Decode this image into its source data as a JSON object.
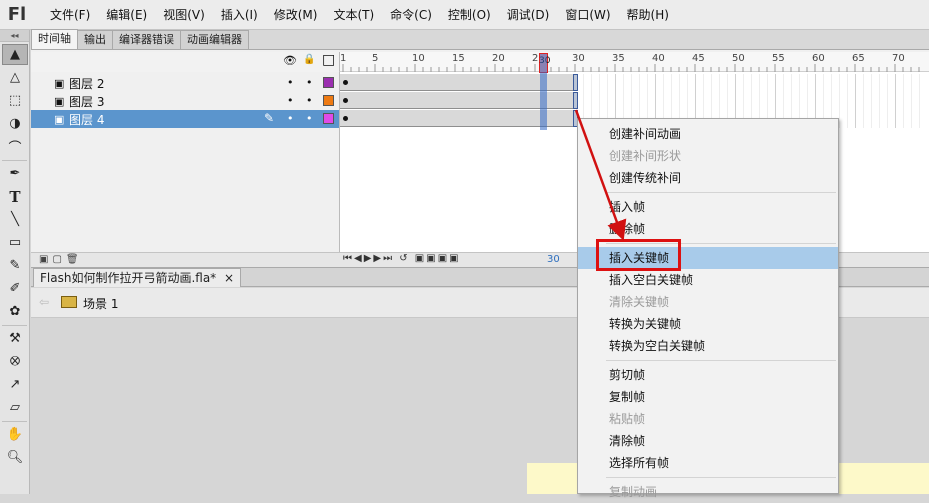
{
  "app": {
    "logo": "Fl"
  },
  "menubar": {
    "items": [
      "文件(F)",
      "编辑(E)",
      "视图(V)",
      "插入(I)",
      "修改(M)",
      "文本(T)",
      "命令(C)",
      "控制(O)",
      "调试(D)",
      "窗口(W)",
      "帮助(H)"
    ]
  },
  "toolbar": {
    "collapse": "◂◂"
  },
  "timeline": {
    "tabs": [
      "时间轴",
      "输出",
      "编译器错误",
      "动画编辑器"
    ],
    "active_tab": 0,
    "header_icons": {
      "eye": "👁",
      "lock": "🔒",
      "outline": "□"
    },
    "ruler_labels": [
      "1",
      "5",
      "10",
      "15",
      "20",
      "25",
      "30",
      "35",
      "40",
      "45",
      "50",
      "55",
      "60",
      "65",
      "70"
    ],
    "current_frame": "30",
    "layers": [
      {
        "name": "图层 2",
        "color": "#9b2fb0",
        "selected": false
      },
      {
        "name": "图层 3",
        "color": "#ee7a12",
        "selected": false
      },
      {
        "name": "图层 4",
        "color": "#e04ae8",
        "selected": true
      }
    ],
    "footer_frame": "30"
  },
  "document": {
    "tab_title": "Flash如何制作拉开弓箭动画.fla*",
    "tab_close": "×",
    "scene_label": "场景 1"
  },
  "context_menu": {
    "items": [
      {
        "label": "创建补间动画",
        "disabled": false
      },
      {
        "label": "创建补间形状",
        "disabled": true
      },
      {
        "label": "创建传统补间",
        "disabled": false
      },
      {
        "label": "插入帧",
        "disabled": false
      },
      {
        "label": "删除帧",
        "disabled": false
      },
      {
        "label": "插入关键帧",
        "disabled": false,
        "hover": true
      },
      {
        "label": "插入空白关键帧",
        "disabled": false
      },
      {
        "label": "清除关键帧",
        "disabled": true
      },
      {
        "label": "转换为关键帧",
        "disabled": false
      },
      {
        "label": "转换为空白关键帧",
        "disabled": false
      },
      {
        "label": "剪切帧",
        "disabled": false
      },
      {
        "label": "复制帧",
        "disabled": false
      },
      {
        "label": "粘贴帧",
        "disabled": true
      },
      {
        "label": "清除帧",
        "disabled": false
      },
      {
        "label": "选择所有帧",
        "disabled": false
      },
      {
        "label": "复制动画",
        "disabled": true
      }
    ]
  },
  "colors": {
    "selection": "#5b95cd",
    "highlight_menu": "#a8cbea",
    "annotation": "#d11111"
  }
}
